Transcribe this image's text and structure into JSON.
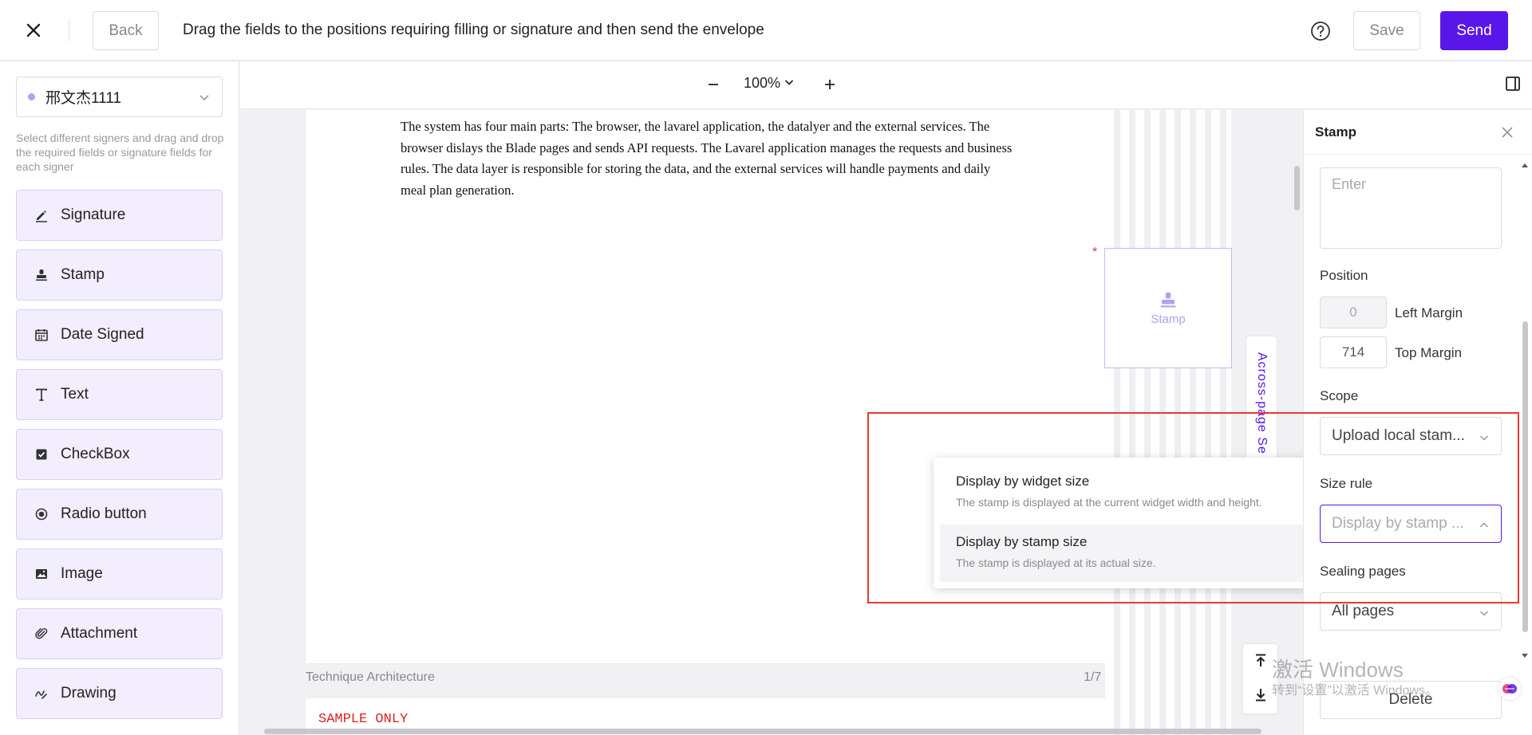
{
  "topbar": {
    "back_label": "Back",
    "instruction": "Drag the fields to the positions requiring filling or signature and then send the envelope",
    "save_label": "Save",
    "send_label": "Send"
  },
  "sidebar": {
    "signer_name": "邢文杰1111",
    "help_text": "Select different signers and drag and drop the required fields or signature fields for each signer",
    "fields": [
      {
        "label": "Signature",
        "icon": "signature-icon"
      },
      {
        "label": "Stamp",
        "icon": "stamp-icon"
      },
      {
        "label": "Date Signed",
        "icon": "calendar-icon"
      },
      {
        "label": "Text",
        "icon": "text-icon"
      },
      {
        "label": "CheckBox",
        "icon": "checkbox-icon"
      },
      {
        "label": "Radio button",
        "icon": "radio-icon"
      },
      {
        "label": "Image",
        "icon": "image-icon"
      },
      {
        "label": "Attachment",
        "icon": "paperclip-icon"
      },
      {
        "label": "Drawing",
        "icon": "drawing-icon"
      }
    ]
  },
  "doc_toolbar": {
    "zoom": "100%"
  },
  "document": {
    "page_text": "The system has four main parts: The browser, the lavarel application, the datalyer and the external services. The browser dislays the Blade pages and sends API requests. The Lavarel application manages the requests and business rules. The data layer is responsible for storing the data, and the external services will handle payments and daily meal plan generation.",
    "stamp_widget_label": "Stamp",
    "required_marker": "*",
    "across_page_tab": "Across-page Se",
    "footer_title": "Technique Architecture",
    "page_indicator": "1/7",
    "next_page_text": "SAMPLE ONLY"
  },
  "size_popup": {
    "options": [
      {
        "title": "Display by widget size",
        "desc": "The stamp is displayed at the current widget width and height."
      },
      {
        "title": "Display by stamp size",
        "desc": "The stamp is displayed at its actual size."
      }
    ]
  },
  "right_panel": {
    "title": "Stamp",
    "textarea_placeholder": "Enter",
    "position_label": "Position",
    "left_margin_value": "0",
    "left_margin_label": "Left Margin",
    "top_margin_value": "714",
    "top_margin_label": "Top Margin",
    "scope_label": "Scope",
    "scope_value": "Upload local stam...",
    "size_rule_label": "Size rule",
    "size_rule_value": "Display by stamp ...",
    "sealing_pages_label": "Sealing pages",
    "sealing_pages_value": "All pages",
    "delete_label": "Delete"
  },
  "watermark": {
    "title": "激活 Windows",
    "subtitle": "转到“设置”以激活 Windows。"
  },
  "colors": {
    "accent": "#5a16e8",
    "field_bg": "#f2eefe",
    "highlight": "#e53935"
  }
}
